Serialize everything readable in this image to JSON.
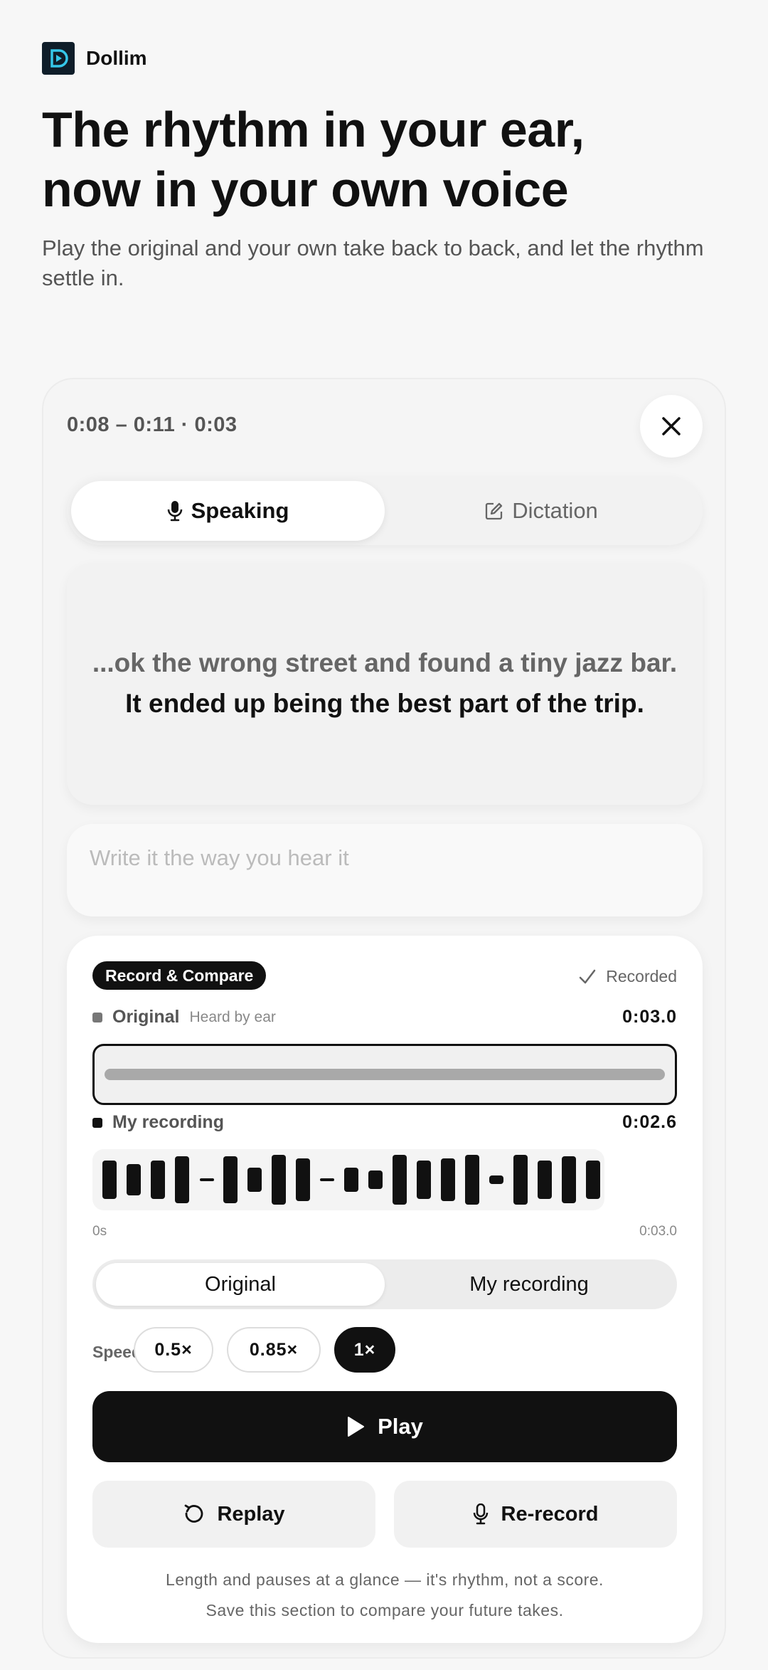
{
  "brand": {
    "name": "Dollim",
    "logo_icon": "play-badge-icon"
  },
  "hero": {
    "title_line1": "The rhythm in your ear,",
    "title_line2": "now in your own voice",
    "subtitle": "Play the original and your own take back to back, and let the rhythm settle in."
  },
  "card": {
    "time_range": "0:08 – 0:11 · 0:03",
    "close_icon": "close-icon",
    "tabs": [
      {
        "label": "Speaking",
        "icon": "microphone-icon",
        "active": true
      },
      {
        "label": "Dictation",
        "icon": "edit-icon",
        "active": false
      }
    ],
    "sentence_prev": "...ok the wrong street and found a tiny jazz bar.",
    "sentence_current": "It ended up being the best part of the trip.",
    "answer": {
      "placeholder": "Write it the way you hear it",
      "value": ""
    }
  },
  "record_compare": {
    "badge": "Record & Compare",
    "status": "Recorded",
    "original": {
      "name": "Original",
      "hint": "Heard by ear",
      "duration": "0:03.0",
      "color": "#777777"
    },
    "my_recording": {
      "name": "My recording",
      "duration": "0:02.6",
      "color": "#111111"
    },
    "scale_start": "0s",
    "scale_end": "0:03.0",
    "compare_options": [
      "Original",
      "My recording"
    ],
    "compare_selected": "Original",
    "speed_label": "Speed",
    "speeds": [
      "0.5×",
      "0.85×",
      "1×"
    ],
    "speed_selected": "1×",
    "play_label": "Play",
    "replay_label": "Replay",
    "rerecord_label": "Re-record",
    "note_line1": "Length and pauses at a glance — it's rhythm, not a score.",
    "note_line2": "Save this section to compare your future takes."
  },
  "colors": {
    "accent": "#111111",
    "logo_bg": "#0f1d29",
    "logo_fg": "#35c6e8"
  }
}
